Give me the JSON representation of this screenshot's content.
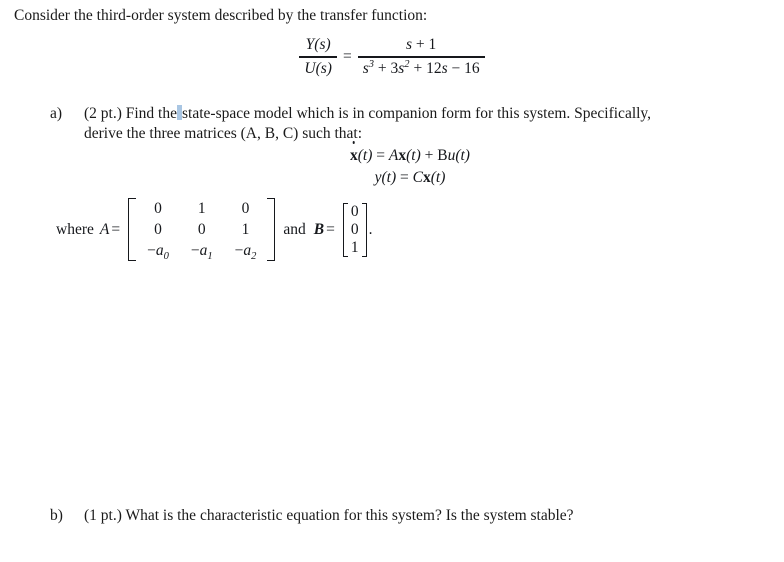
{
  "document": {
    "background_color": "#ffffff",
    "text_color": "#1a1a1a",
    "intro": "Consider the third-order system described by the transfer function:"
  },
  "transfer_function": {
    "numerator_left": "Y(s)",
    "denominator_left": "U(s)",
    "equals": "=",
    "numerator_right_plain": "s + 1",
    "numerator_right": {
      "var": "s",
      "plus": "+",
      "constant": "1"
    },
    "denominator_right_plain": "s³ + 3s² + 12s − 16",
    "denominator_right": {
      "term1_var": "s",
      "term1_pow": "3",
      "op1": "+",
      "term2_coef": "3",
      "term2_var": "s",
      "term2_pow": "2",
      "op2": "+",
      "term3_coef": "12",
      "term3_var": "s",
      "op3": "−",
      "term4_const": "16"
    }
  },
  "items": [
    {
      "marker": "a)",
      "line1_pre": "(2 pt.) Find the",
      "line1_post": "state-space model which is in companion form for this system. Specifically,",
      "line2": "derive the three matrices (A, B, C) such that:",
      "caret_color": "#a9c6e3"
    },
    {
      "marker": "b)",
      "line1": "(1 pt.) What is the characteristic equation for this system? Is the system stable?"
    }
  ],
  "state_space": {
    "eq1": {
      "lhs_var": "x",
      "lhs_arg": "(t)",
      "equals": "=",
      "term1_matrix": "A",
      "term1_var": "x",
      "term1_arg": "(t)",
      "plus": "+",
      "term2_matrix": "B",
      "term2_var": "u",
      "term2_arg": "(t)"
    },
    "eq2": {
      "lhs_var": "y",
      "lhs_arg": "(t)",
      "equals": "=",
      "rhs_matrix": "C",
      "rhs_var": "x",
      "rhs_arg": "(t)"
    }
  },
  "matrices": {
    "where_label": "where",
    "a_name": "A",
    "equals": "=",
    "and_label": "and",
    "b_name": "B",
    "equals2": "=",
    "period": ".",
    "A": {
      "rows": [
        [
          "0",
          "1",
          "0"
        ],
        [
          "0",
          "0",
          "1"
        ],
        [
          "−a₀",
          "−a₁",
          "−a₂"
        ]
      ],
      "row3_cells": [
        {
          "sign": "−",
          "base": "a",
          "sub": "0"
        },
        {
          "sign": "−",
          "base": "a",
          "sub": "1"
        },
        {
          "sign": "−",
          "base": "a",
          "sub": "2"
        }
      ]
    },
    "B": {
      "rows": [
        [
          "0"
        ],
        [
          "0"
        ],
        [
          "1"
        ]
      ]
    }
  }
}
